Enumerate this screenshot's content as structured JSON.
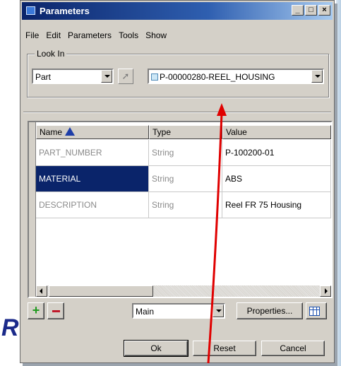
{
  "window": {
    "title": "Parameters",
    "controls": [
      "minimize",
      "maximize",
      "close"
    ]
  },
  "menu": [
    "File",
    "Edit",
    "Parameters",
    "Tools",
    "Show"
  ],
  "look_in": {
    "legend": "Look In",
    "type_value": "Part",
    "object_value": "P-00000280-REEL_HOUSING"
  },
  "table": {
    "columns": [
      "Name",
      "Type",
      "Value"
    ],
    "rows": [
      {
        "name": "PART_NUMBER",
        "type": "String",
        "value": "P-100200-01",
        "selected": false
      },
      {
        "name": "MATERIAL",
        "type": "String",
        "value": "ABS",
        "selected": true
      },
      {
        "name": "DESCRIPTION",
        "type": "String",
        "value": "Reel FR 75 Housing",
        "selected": false
      }
    ]
  },
  "bottom": {
    "filter_value": "Main",
    "properties_label": "Properties...",
    "ok_label": "Ok",
    "reset_label": "Reset",
    "cancel_label": "Cancel"
  },
  "side_text": "R",
  "colors": {
    "titlebar": "#0a246a",
    "selection": "#0a246a",
    "annotation_arrow": "#e00000",
    "add_icon": "#1f9a1f",
    "remove_icon": "#c0182a"
  },
  "icons": [
    "parameters-window-icon",
    "select-arrow-icon",
    "part-icon",
    "sort-ascending-icon",
    "plus-icon",
    "minus-icon",
    "column-layout-icon"
  ]
}
